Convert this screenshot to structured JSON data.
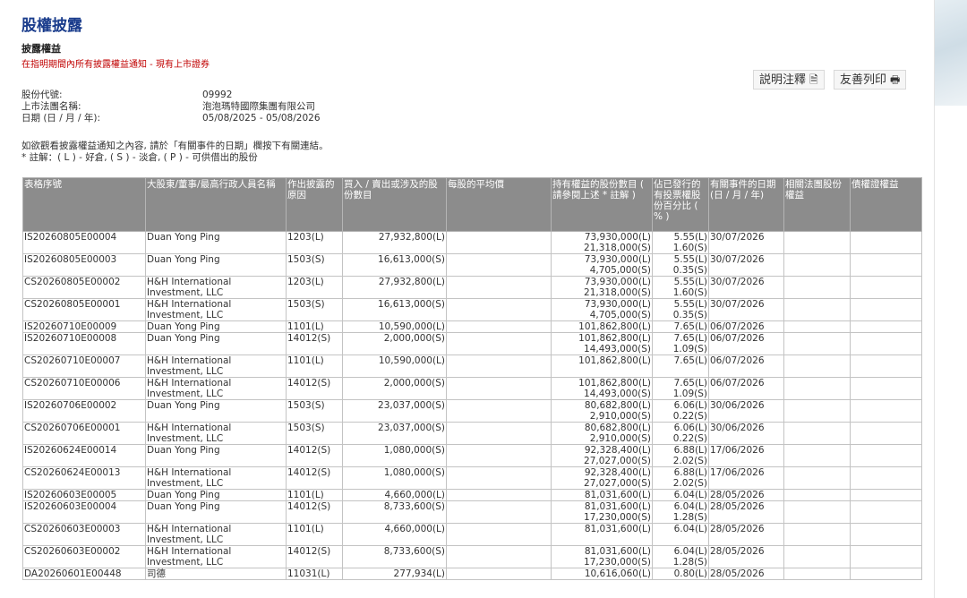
{
  "header": {
    "title": "股權披露",
    "subtitle": "披露權益",
    "notice": "在指明期間內所有披露權益通知 - 現有上市證券"
  },
  "toolbar": {
    "explain_label": "説明注釋",
    "print_label": "友善列印"
  },
  "info": [
    {
      "label": "股份代號:",
      "value": "09992"
    },
    {
      "label": "上市法團名稱:",
      "value": "泡泡瑪特國際集團有限公司"
    },
    {
      "label": "日期 (日 / 月 / 年):",
      "value": "05/08/2025 - 05/08/2026"
    }
  ],
  "hint": {
    "line1": "如欲觀看披露權益通知之內容, 請於「有關事件的日期」欄按下有關連結。",
    "line2": "* 註解：( L ) - 好倉, ( S ) - 淡倉, ( P ) - 可供借出的股份"
  },
  "columns": [
    "表格序號",
    "大股東/董事/最高行政人員名稱",
    "作出披露的原因",
    "買入 / 賣出或涉及的股份數目",
    "每股的平均價",
    "持有權益的股份數目 ( 請參閱上述 * 註解 )",
    "佔已發行的有投票權股份百分比 ( % )",
    "有關事件的日期 (日 / 月 / 年)",
    "相關法團股份權益",
    "債權證權益"
  ],
  "rows": [
    {
      "id": "IS20260805E00004",
      "name": "Duan Yong Ping",
      "reason": "1203(L)",
      "qty": "27,932,800(L)",
      "avg": "",
      "held": [
        "73,930,000(L)",
        "21,318,000(S)"
      ],
      "pct": [
        "5.55(L)",
        "1.60(S)"
      ],
      "date": "30/07/2026"
    },
    {
      "id": "IS20260805E00003",
      "name": "Duan Yong Ping",
      "reason": "1503(S)",
      "qty": "16,613,000(S)",
      "avg": "",
      "held": [
        "73,930,000(L)",
        "4,705,000(S)"
      ],
      "pct": [
        "5.55(L)",
        "0.35(S)"
      ],
      "date": "30/07/2026"
    },
    {
      "id": "CS20260805E00002",
      "name": "H&H International Investment, LLC",
      "reason": "1203(L)",
      "qty": "27,932,800(L)",
      "avg": "",
      "held": [
        "73,930,000(L)",
        "21,318,000(S)"
      ],
      "pct": [
        "5.55(L)",
        "1.60(S)"
      ],
      "date": "30/07/2026"
    },
    {
      "id": "CS20260805E00001",
      "name": "H&H International Investment, LLC",
      "reason": "1503(S)",
      "qty": "16,613,000(S)",
      "avg": "",
      "held": [
        "73,930,000(L)",
        "4,705,000(S)"
      ],
      "pct": [
        "5.55(L)",
        "0.35(S)"
      ],
      "date": "30/07/2026"
    },
    {
      "id": "IS20260710E00009",
      "name": "Duan Yong Ping",
      "reason": "1101(L)",
      "qty": "10,590,000(L)",
      "avg": "",
      "held": [
        "101,862,800(L)"
      ],
      "pct": [
        "7.65(L)"
      ],
      "date": "06/07/2026"
    },
    {
      "id": "IS20260710E00008",
      "name": "Duan Yong Ping",
      "reason": "14012(S)",
      "qty": "2,000,000(S)",
      "avg": "",
      "held": [
        "101,862,800(L)",
        "14,493,000(S)"
      ],
      "pct": [
        "7.65(L)",
        "1.09(S)"
      ],
      "date": "06/07/2026"
    },
    {
      "id": "CS20260710E00007",
      "name": "H&H International Investment, LLC",
      "reason": "1101(L)",
      "qty": "10,590,000(L)",
      "avg": "",
      "held": [
        "101,862,800(L)"
      ],
      "pct": [
        "7.65(L)"
      ],
      "date": "06/07/2026"
    },
    {
      "id": "CS20260710E00006",
      "name": "H&H International Investment, LLC",
      "reason": "14012(S)",
      "qty": "2,000,000(S)",
      "avg": "",
      "held": [
        "101,862,800(L)",
        "14,493,000(S)"
      ],
      "pct": [
        "7.65(L)",
        "1.09(S)"
      ],
      "date": "06/07/2026"
    },
    {
      "id": "IS20260706E00002",
      "name": "Duan Yong Ping",
      "reason": "1503(S)",
      "qty": "23,037,000(S)",
      "avg": "",
      "held": [
        "80,682,800(L)",
        "2,910,000(S)"
      ],
      "pct": [
        "6.06(L)",
        "0.22(S)"
      ],
      "date": "30/06/2026"
    },
    {
      "id": "CS20260706E00001",
      "name": "H&H International Investment, LLC",
      "reason": "1503(S)",
      "qty": "23,037,000(S)",
      "avg": "",
      "held": [
        "80,682,800(L)",
        "2,910,000(S)"
      ],
      "pct": [
        "6.06(L)",
        "0.22(S)"
      ],
      "date": "30/06/2026"
    },
    {
      "id": "IS20260624E00014",
      "name": "Duan Yong Ping",
      "reason": "14012(S)",
      "qty": "1,080,000(S)",
      "avg": "",
      "held": [
        "92,328,400(L)",
        "27,027,000(S)"
      ],
      "pct": [
        "6.88(L)",
        "2.02(S)"
      ],
      "date": "17/06/2026"
    },
    {
      "id": "CS20260624E00013",
      "name": "H&H International Investment, LLC",
      "reason": "14012(S)",
      "qty": "1,080,000(S)",
      "avg": "",
      "held": [
        "92,328,400(L)",
        "27,027,000(S)"
      ],
      "pct": [
        "6.88(L)",
        "2.02(S)"
      ],
      "date": "17/06/2026"
    },
    {
      "id": "IS20260603E00005",
      "name": "Duan Yong Ping",
      "reason": "1101(L)",
      "qty": "4,660,000(L)",
      "avg": "",
      "held": [
        "81,031,600(L)"
      ],
      "pct": [
        "6.04(L)"
      ],
      "date": "28/05/2026"
    },
    {
      "id": "IS20260603E00004",
      "name": "Duan Yong Ping",
      "reason": "14012(S)",
      "qty": "8,733,600(S)",
      "avg": "",
      "held": [
        "81,031,600(L)",
        "17,230,000(S)"
      ],
      "pct": [
        "6.04(L)",
        "1.28(S)"
      ],
      "date": "28/05/2026"
    },
    {
      "id": "CS20260603E00003",
      "name": "H&H International Investment, LLC",
      "reason": "1101(L)",
      "qty": "4,660,000(L)",
      "avg": "",
      "held": [
        "81,031,600(L)"
      ],
      "pct": [
        "6.04(L)"
      ],
      "date": "28/05/2026"
    },
    {
      "id": "CS20260603E00002",
      "name": "H&H International Investment, LLC",
      "reason": "14012(S)",
      "qty": "8,733,600(S)",
      "avg": "",
      "held": [
        "81,031,600(L)",
        "17,230,000(S)"
      ],
      "pct": [
        "6.04(L)",
        "1.28(S)"
      ],
      "date": "28/05/2026"
    },
    {
      "id": "DA20260601E00448",
      "name": "司德",
      "reason": "11031(L)",
      "qty": "277,934(L)",
      "avg": "",
      "held": [
        "10,616,060(L)"
      ],
      "pct": [
        "0.80(L)"
      ],
      "date": "28/05/2026"
    }
  ],
  "colors": {
    "title": "#1a3c8c",
    "notice": "#c00000",
    "header_bg": "#8c8c8c",
    "link": "#1a3c8c"
  }
}
